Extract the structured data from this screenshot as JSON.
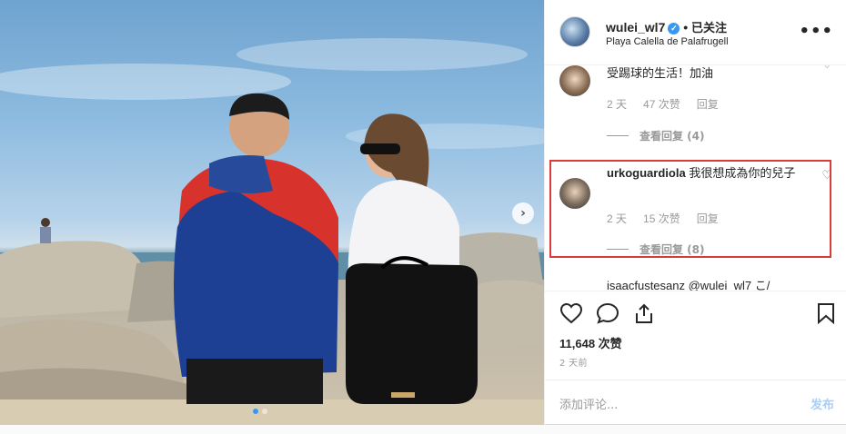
{
  "post": {
    "username": "wulei_wl7",
    "verified_icon": "verified-check-icon",
    "separator": "•",
    "follow_status": "已关注",
    "location": "Playa Calella de Palafrugell",
    "more_icon": "more-options-icon"
  },
  "comments": [
    {
      "text": "受踢球的生活！加油",
      "age": "2 天",
      "likes": "47 次赞",
      "reply": "回复",
      "view_replies": "查看回复 (4)"
    },
    {
      "username": "urkoguardiola",
      "text": "我很想成為你的兒子",
      "age": "2 天",
      "likes": "15 次赞",
      "reply": "回复",
      "view_replies": "查看回复 (8)"
    },
    {
      "partial": "isaacfustesanz @wulei_wl7 こ/"
    }
  ],
  "actions": {
    "like_icon": "heart-icon",
    "comment_icon": "comment-bubble-icon",
    "share_icon": "share-icon",
    "save_icon": "bookmark-icon",
    "likes_count": "11,648 次赞",
    "posted": "2 天前"
  },
  "composer": {
    "placeholder": "添加评论...",
    "submit": "发布"
  },
  "colors": {
    "accent": "#3897f0",
    "highlight_border": "#d93a3a"
  }
}
